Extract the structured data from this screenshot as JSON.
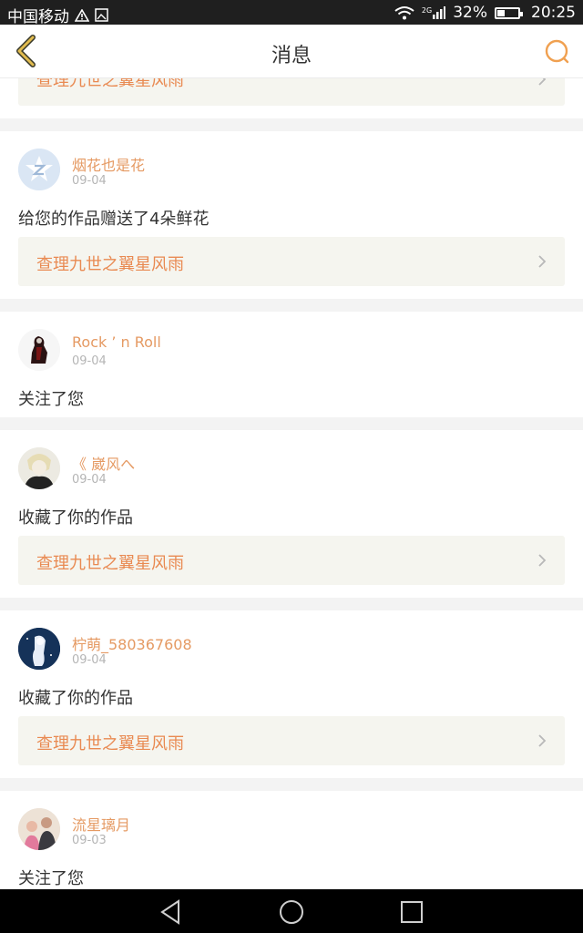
{
  "status_bar": {
    "carrier": "中国移动",
    "network": "2G",
    "battery": "32%",
    "time": "20:25"
  },
  "header": {
    "title": "消息",
    "back_icon": "chevron-left-icon",
    "search_icon": "search-icon"
  },
  "messages": [
    {
      "work_title": "查理九世之翼星风雨"
    },
    {
      "username": "烟花也是花",
      "date": "09-04",
      "action": "给您的作品赠送了4朵鲜花",
      "work_title": "查理九世之翼星风雨"
    },
    {
      "username": "Rock ’ n Roll",
      "date": "09-04",
      "action": "关注了您"
    },
    {
      "username": "《 崴风へ",
      "date": "09-04",
      "action": "收藏了你的作品",
      "work_title": "查理九世之翼星风雨"
    },
    {
      "username": "柠萌_580367608",
      "date": "09-04",
      "action": "收藏了你的作品",
      "work_title": "查理九世之翼星风雨"
    },
    {
      "username": "流星璃月",
      "date": "09-03",
      "action": "关注了您"
    }
  ],
  "colors": {
    "accent": "#e59a63",
    "link": "#e98a52",
    "back_icon": "#d9b24a"
  }
}
